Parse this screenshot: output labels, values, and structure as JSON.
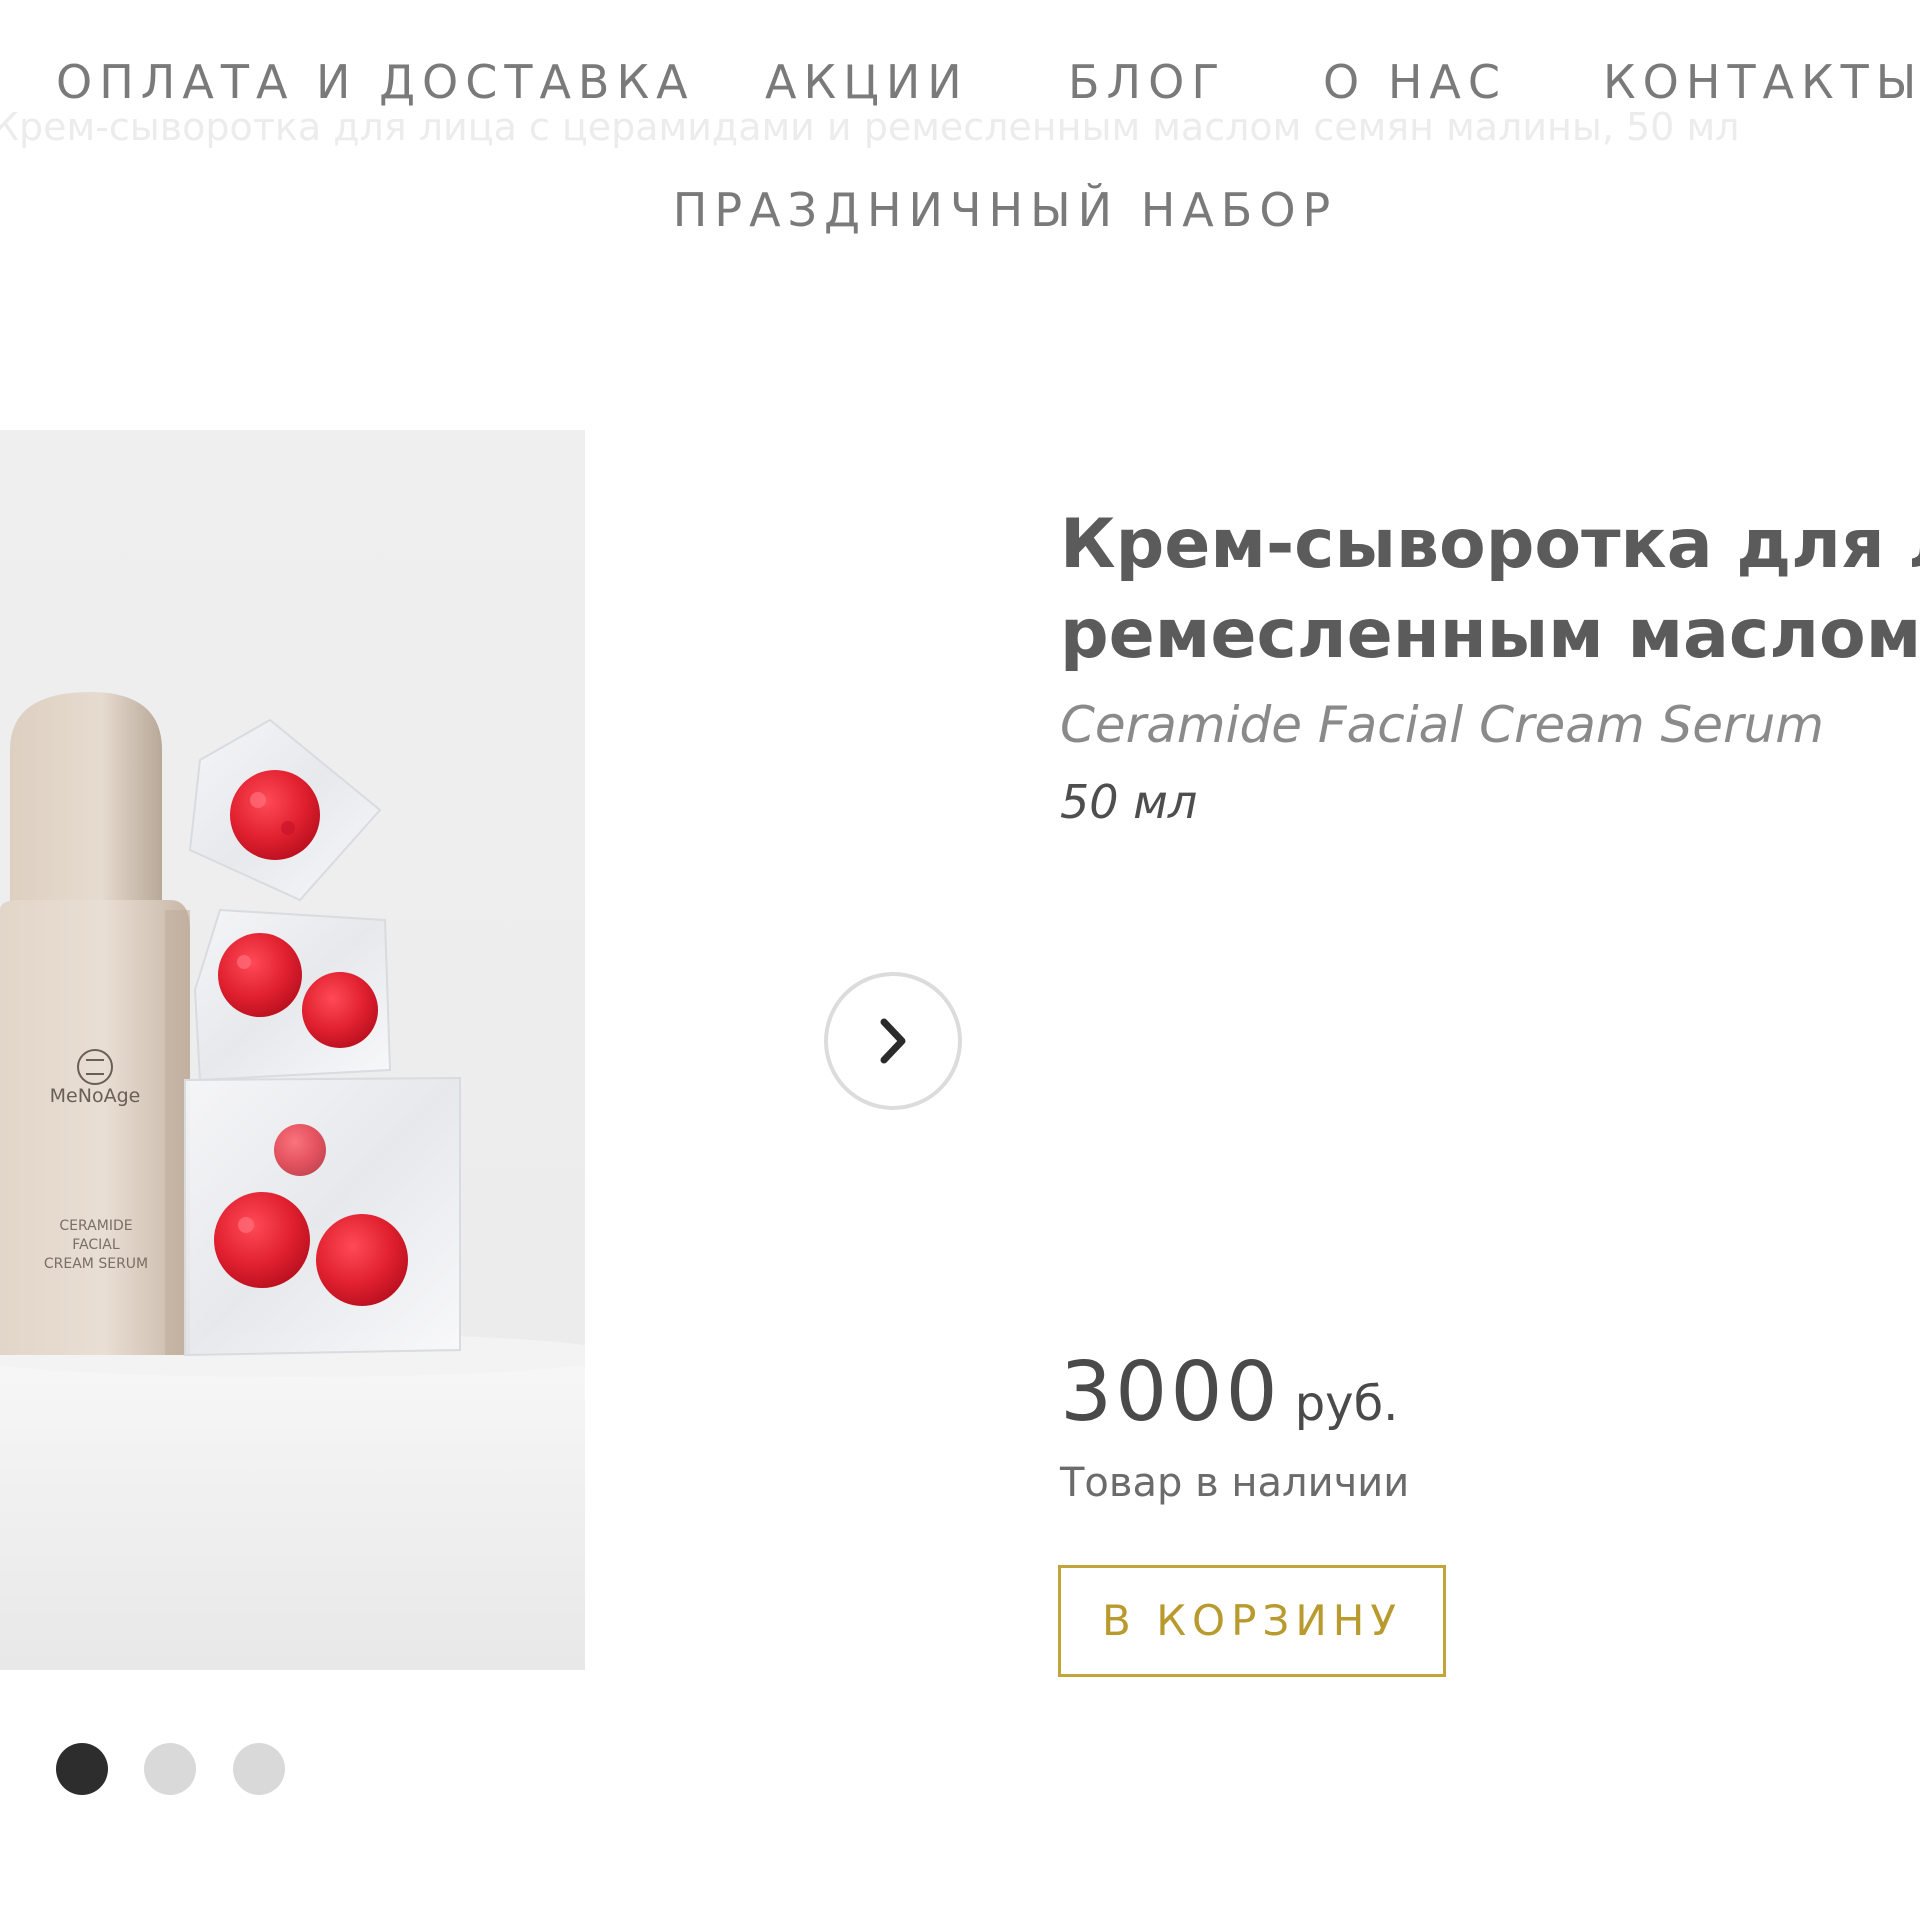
{
  "nav": {
    "items": [
      {
        "label": "ОПЛАТА И ДОСТАВКА"
      },
      {
        "label": "АКЦИИ"
      },
      {
        "label": "БЛОГ"
      },
      {
        "label": "О НАС"
      },
      {
        "label": "КОНТАКТЫ"
      }
    ],
    "second_row": [
      {
        "label": "ПРАЗДНИЧНЫЙ НАБОР"
      }
    ]
  },
  "breadcrumb_ghost": "Крем-сыворотка для лица с церамидами и ремесленным маслом семян малины, 50 мл",
  "gallery": {
    "bottle_brand": "MeNoAge",
    "bottle_label": [
      "CERAMIDE",
      "FACIAL",
      "CREAM SERUM"
    ],
    "slide_count": 3,
    "active_slide": 1
  },
  "product": {
    "title_line1": "Крем-сыворотка для лица с церамидами и",
    "title_line2": "ремесленным маслом семян малины",
    "subtitle": "Ceramide Facial Cream Serum",
    "volume": "50 мл",
    "price": "3000",
    "currency": "руб.",
    "stock": "Товар в наличии",
    "cart_button": "В КОРЗИНУ"
  },
  "colors": {
    "accent": "#c2a43a",
    "text": "#4a4a4a",
    "nav": "#7a7a7a",
    "dot_active": "#2d2d2d",
    "dot_inactive": "#d9d9d9"
  }
}
